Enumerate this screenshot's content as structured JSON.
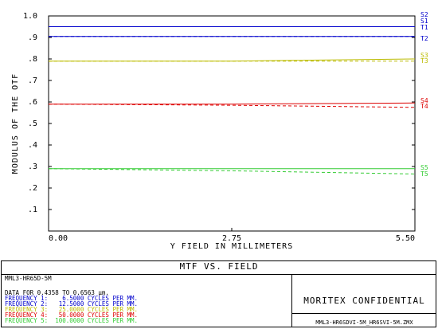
{
  "chart_data": {
    "type": "line",
    "title": "MTF VS. FIELD",
    "xlabel": "Y FIELD IN MILLIMETERS",
    "ylabel": "MODULUS OF THE OTF",
    "xlim": [
      0,
      5.5
    ],
    "ylim": [
      0,
      1.0
    ],
    "x_ticks": [
      "0.00",
      "2.75",
      "5.50"
    ],
    "y_ticks": [
      "1.0",
      ".9",
      ".8",
      ".7",
      ".6",
      ".5",
      ".4",
      ".3",
      ".2",
      ".1"
    ],
    "grid": false,
    "series": [
      {
        "name": "S1",
        "color": "#0000cc",
        "dash": false,
        "x": [
          0,
          5.5
        ],
        "y": [
          0.95,
          0.95
        ]
      },
      {
        "name": "T1",
        "color": "#0000cc",
        "dash": true,
        "x": [
          0,
          5.5
        ],
        "y": [
          0.95,
          0.95
        ]
      },
      {
        "name": "S2",
        "color": "#0000cc",
        "dash": false,
        "x": [
          0,
          5.5
        ],
        "y": [
          0.905,
          0.905
        ]
      },
      {
        "name": "T2",
        "color": "#0000cc",
        "dash": true,
        "x": [
          0,
          5.5
        ],
        "y": [
          0.905,
          0.905
        ]
      },
      {
        "name": "S3",
        "color": "#bbbb00",
        "dash": false,
        "x": [
          0,
          2.75,
          5.5
        ],
        "y": [
          0.79,
          0.79,
          0.8
        ]
      },
      {
        "name": "T3",
        "color": "#bbbb00",
        "dash": true,
        "x": [
          0,
          2.75,
          5.5
        ],
        "y": [
          0.79,
          0.79,
          0.79
        ]
      },
      {
        "name": "S4",
        "color": "#dd0000",
        "dash": false,
        "x": [
          0,
          2.75,
          5.5
        ],
        "y": [
          0.59,
          0.59,
          0.595
        ]
      },
      {
        "name": "T4",
        "color": "#dd0000",
        "dash": true,
        "x": [
          0,
          2.75,
          5.5
        ],
        "y": [
          0.59,
          0.585,
          0.575
        ]
      },
      {
        "name": "S5",
        "color": "#33cc33",
        "dash": false,
        "x": [
          0,
          2.75,
          5.5
        ],
        "y": [
          0.29,
          0.29,
          0.29
        ]
      },
      {
        "name": "T5",
        "color": "#33cc33",
        "dash": true,
        "x": [
          0,
          2.75,
          5.5
        ],
        "y": [
          0.29,
          0.28,
          0.265
        ]
      }
    ],
    "right_labels": [
      {
        "text": "S2",
        "color": "#0000cc"
      },
      {
        "text": "S1",
        "color": "#0000cc"
      },
      {
        "text": "T1",
        "color": "#0000cc"
      },
      {
        "text": "T2",
        "color": "#0000cc"
      },
      {
        "text": "S3",
        "color": "#bbbb00"
      },
      {
        "text": "T3",
        "color": "#bbbb00"
      },
      {
        "text": "S4",
        "color": "#dd0000"
      },
      {
        "text": "T4",
        "color": "#dd0000"
      },
      {
        "text": "S5",
        "color": "#33cc33"
      },
      {
        "text": "T5",
        "color": "#33cc33"
      }
    ]
  },
  "info": {
    "lens_name": "MML3-HR65D-5M",
    "data_range": "DATA FOR 0.4358 TO 0.6563 µm.",
    "frequencies": [
      {
        "label": "FREQUENCY 1:",
        "value": "6.5000",
        "unit": "CYCLES PER MM.",
        "color": "#0000cc"
      },
      {
        "label": "FREQUENCY 2:",
        "value": "12.5000",
        "unit": "CYCLES PER MM.",
        "color": "#0000cc"
      },
      {
        "label": "FREQUENCY 3:",
        "value": "25.0000",
        "unit": "CYCLES PER MM.",
        "color": "#bbbb00"
      },
      {
        "label": "FREQUENCY 4:",
        "value": "50.0000",
        "unit": "CYCLES PER MM.",
        "color": "#dd0000"
      },
      {
        "label": "FREQUENCY 5:",
        "value": "100.0000",
        "unit": "CYCLES PER MM.",
        "color": "#33cc33"
      }
    ],
    "confidential": "MORITEX CONFIDENTIAL",
    "filename": "MML3-HR6SDVI-5M_HR6SVI-5M.ZMX"
  }
}
